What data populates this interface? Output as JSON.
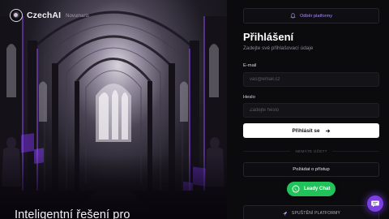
{
  "brand": {
    "name": "CzechAI",
    "tagline": "Novumaris"
  },
  "hero": {
    "headline": "Inteligentní řešení pro"
  },
  "panel": {
    "subscribe_label": "Odběr platformy",
    "title": "Přihlášení",
    "subtitle": "Zadejte své přihlašovací údaje",
    "email": {
      "label": "E-mail",
      "placeholder": "vas@email.cz",
      "value": ""
    },
    "password": {
      "label": "Heslo",
      "placeholder": "Zadejte heslo",
      "value": ""
    },
    "login_label": "Přihlásit se",
    "divider_text": "NEMÁTE ÚČET?",
    "request_access_label": "Požádat o přístup",
    "launch_label": "SPUŠTĚNÍ PLATFORMY"
  },
  "widgets": {
    "chat_label": "Leady Chat"
  },
  "colors": {
    "accent": "#7b3fe4",
    "accent_text": "#a98bff",
    "chat_green": "#22c25a",
    "panel_bg": "#0b0b0d"
  },
  "icons": {
    "subscribe": "bell-icon",
    "login": "arrow-right-icon",
    "launch": "rocket-icon",
    "chat": "whatsapp-icon",
    "fab": "chat-bubble-icon"
  }
}
